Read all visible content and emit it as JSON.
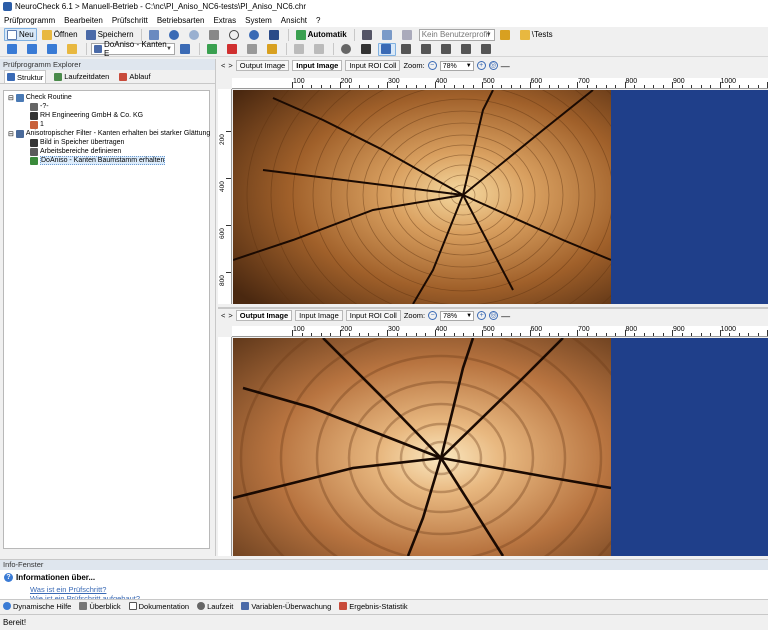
{
  "window": {
    "title": "NeuroCheck 6.1 > Manuell-Betrieb - C:\\nc\\PI_Aniso_NC6-tests\\PI_Aniso_NC6.chr"
  },
  "menu": [
    "Prüfprogramm",
    "Bearbeiten",
    "Prüfschritt",
    "Betriebsarten",
    "Extras",
    "System",
    "Ansicht",
    "?"
  ],
  "toolbar1": {
    "new_label": "Neu",
    "open_label": "Öffnen",
    "save_label": "Speichern",
    "automatic_label": "Automatik",
    "profile_value": "Kein Benutzerprofil",
    "folder_label": "\\Tests"
  },
  "toolbar2": {
    "step_value": "DoAniso - Kanten E"
  },
  "explorer": {
    "title": "Prüfprogramm Explorer",
    "tabs": [
      "Struktur",
      "Laufzeitdaten",
      "Ablauf"
    ],
    "tree": [
      {
        "label": "Check Routine"
      },
      {
        "label": "-?-"
      },
      {
        "label": "RH Engineering GmbH & Co. KG"
      },
      {
        "label": "1"
      },
      {
        "label": "Anisotropischer Filter - Kanten erhalten bei starker Glättung"
      },
      {
        "label": "Bild in Speicher übertragen"
      },
      {
        "label": "Arbeitsbereiche definieren"
      },
      {
        "label": "DoAniso - Kanten Baumstamm erhalten"
      }
    ]
  },
  "viewer1": {
    "tabs": [
      "Output Image",
      "Input Image",
      "Input ROI Coll"
    ],
    "zoom_label": "Zoom:",
    "zoom_value": "78%",
    "hruler": [
      "100",
      "200",
      "300",
      "400",
      "500",
      "600",
      "700",
      "800",
      "900",
      "1000",
      "1100"
    ],
    "vruler": [
      "200",
      "400",
      "600",
      "800"
    ]
  },
  "viewer2": {
    "tabs": [
      "Output Image",
      "Input Image",
      "Input ROI Coll"
    ],
    "zoom_label": "Zoom:",
    "zoom_value": "78%",
    "hruler": [
      "100",
      "200",
      "300",
      "400",
      "500",
      "600",
      "700",
      "800",
      "900",
      "1000",
      "1100"
    ]
  },
  "info": {
    "title": "Info-Fenster",
    "heading": "Informationen über...",
    "links": [
      "Was ist ein Prüfschritt?",
      "Wie ist ein Prüfschritt aufgebaut?"
    ]
  },
  "bottom_tabs": [
    "Dynamische Hilfe",
    "Überblick",
    "Dokumentation",
    "Laufzeit",
    "Variablen-Überwachung",
    "Ergebnis-Statistik"
  ],
  "status": {
    "text": "Bereit!"
  },
  "colors": {
    "accent": "#3a6ab5",
    "image_bg": "#1f3f8a",
    "selection": "#dcecfc"
  }
}
